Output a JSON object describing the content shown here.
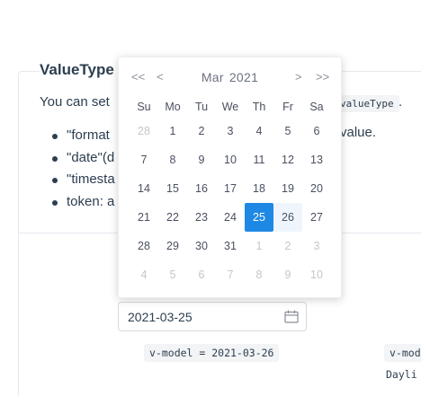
{
  "section": {
    "title": "ValueType",
    "intro": "You can set",
    "intro_code": "valueType",
    "intro_end": ".",
    "bullets": [
      "\"format",
      "\"date\"(d",
      "\"timesta",
      "token: a"
    ],
    "bullet_tail": "value."
  },
  "input": {
    "value": "2021-03-25"
  },
  "tags": {
    "left": "v-model = 2021-03-26",
    "right": "v-mod",
    "note": "Dayli"
  },
  "picker": {
    "nav": {
      "prev_year": "<<",
      "prev_month": "<",
      "next_month": ">",
      "next_year": ">>"
    },
    "month": "Mar",
    "year": "2021",
    "weekdays": [
      "Su",
      "Mo",
      "Tu",
      "We",
      "Th",
      "Fr",
      "Sa"
    ],
    "weeks": [
      [
        {
          "d": "28",
          "m": true
        },
        {
          "d": "1"
        },
        {
          "d": "2"
        },
        {
          "d": "3"
        },
        {
          "d": "4"
        },
        {
          "d": "5"
        },
        {
          "d": "6"
        }
      ],
      [
        {
          "d": "7"
        },
        {
          "d": "8"
        },
        {
          "d": "9"
        },
        {
          "d": "10"
        },
        {
          "d": "11"
        },
        {
          "d": "12"
        },
        {
          "d": "13"
        }
      ],
      [
        {
          "d": "14"
        },
        {
          "d": "15"
        },
        {
          "d": "16"
        },
        {
          "d": "17"
        },
        {
          "d": "18"
        },
        {
          "d": "19"
        },
        {
          "d": "20"
        }
      ],
      [
        {
          "d": "21"
        },
        {
          "d": "22"
        },
        {
          "d": "23"
        },
        {
          "d": "24"
        },
        {
          "d": "25",
          "s": true
        },
        {
          "d": "26",
          "h": true
        },
        {
          "d": "27"
        }
      ],
      [
        {
          "d": "28"
        },
        {
          "d": "29"
        },
        {
          "d": "30"
        },
        {
          "d": "31"
        },
        {
          "d": "1",
          "m": true
        },
        {
          "d": "2",
          "m": true
        },
        {
          "d": "3",
          "m": true
        }
      ],
      [
        {
          "d": "4",
          "m": true
        },
        {
          "d": "5",
          "m": true
        },
        {
          "d": "6",
          "m": true
        },
        {
          "d": "7",
          "m": true
        },
        {
          "d": "8",
          "m": true
        },
        {
          "d": "9",
          "m": true
        },
        {
          "d": "10",
          "m": true
        }
      ]
    ],
    "colors": {
      "selected": "#1e88e5",
      "hover": "#eef5fd",
      "muted": "#c3c6cc"
    }
  }
}
